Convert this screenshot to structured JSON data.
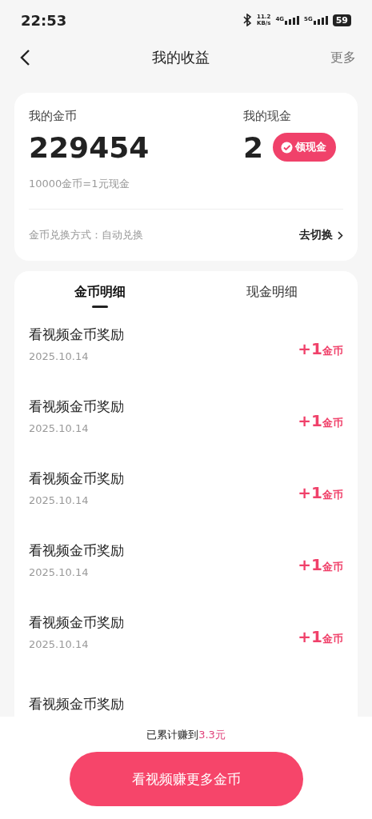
{
  "status_bar": {
    "time": "22:53",
    "speed": "11.2",
    "speed_unit": "KB/s",
    "network_1": "4G",
    "network_2": "5G",
    "battery": "59"
  },
  "header": {
    "title": "我的收益",
    "more": "更多"
  },
  "summary": {
    "coins_label": "我的金币",
    "coins": "229454",
    "rate": "10000金币=1元现金",
    "cash_label": "我的现金",
    "cash": "2",
    "withdraw_button": "领现金",
    "exchange_mode": "金币兑换方式：自动兑换",
    "switch_link": "去切换"
  },
  "tabs": [
    {
      "label": "金币明细",
      "selected": true
    },
    {
      "label": "现金明细",
      "selected": false
    }
  ],
  "records": [
    {
      "title": "看视频金币奖励",
      "date": "2025.10.14",
      "amount": "+1",
      "unit": "金币"
    },
    {
      "title": "看视频金币奖励",
      "date": "2025.10.14",
      "amount": "+1",
      "unit": "金币"
    },
    {
      "title": "看视频金币奖励",
      "date": "2025.10.14",
      "amount": "+1",
      "unit": "金币"
    },
    {
      "title": "看视频金币奖励",
      "date": "2025.10.14",
      "amount": "+1",
      "unit": "金币"
    },
    {
      "title": "看视频金币奖励",
      "date": "2025.10.14",
      "amount": "+1",
      "unit": "金币"
    },
    {
      "title": "看视频金币奖励"
    }
  ],
  "footer": {
    "total_text": "已累计赚到",
    "total_value": "3.3元",
    "button": "看视频赚更多金币"
  }
}
